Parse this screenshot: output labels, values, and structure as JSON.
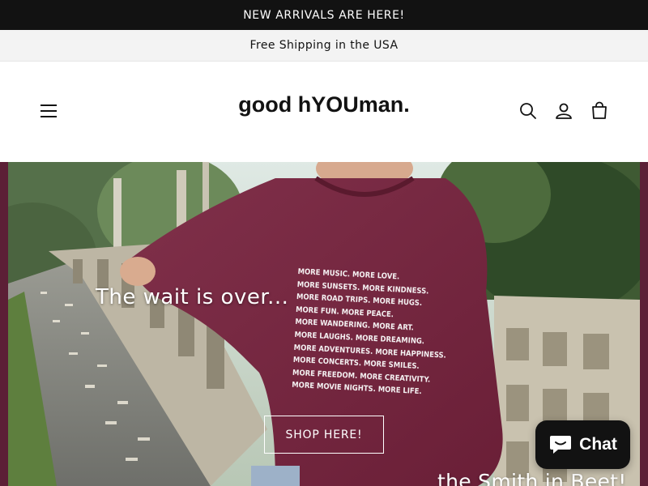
{
  "announcement": {
    "text": "NEW ARRIVALS ARE HERE!"
  },
  "shipping": {
    "text": "Free Shipping in the USA"
  },
  "header": {
    "logo": "good hYOUman.",
    "icons": {
      "menu": "menu-icon",
      "search": "search-icon",
      "account": "account-icon",
      "cart": "cart-icon"
    }
  },
  "hero": {
    "heading": "The wait is over...",
    "button_label": "SHOP HERE!",
    "subheading": "the Smith in Beet!",
    "sweater_lines": [
      "MORE MUSIC. MORE LOVE.",
      "MORE SUNSETS. MORE KINDNESS.",
      "MORE ROAD TRIPS. MORE HUGS.",
      "MORE FUN. MORE PEACE.",
      "MORE WANDERING. MORE ART.",
      "MORE LAUGHS. MORE DREAMING.",
      "MORE ADVENTURES. MORE HAPPINESS.",
      "MORE CONCERTS. MORE SMILES.",
      "MORE FREEDOM. MORE CREATIVITY.",
      "MORE MOVIE NIGHTS. MORE LIFE."
    ]
  },
  "chat": {
    "label": "Chat",
    "icon": "chat-bubble-icon"
  },
  "colors": {
    "announce_bg": "#121212",
    "shipping_bg": "#f3f3f3",
    "hero_frame": "#5c1f36",
    "sweater": "#7a2640"
  }
}
